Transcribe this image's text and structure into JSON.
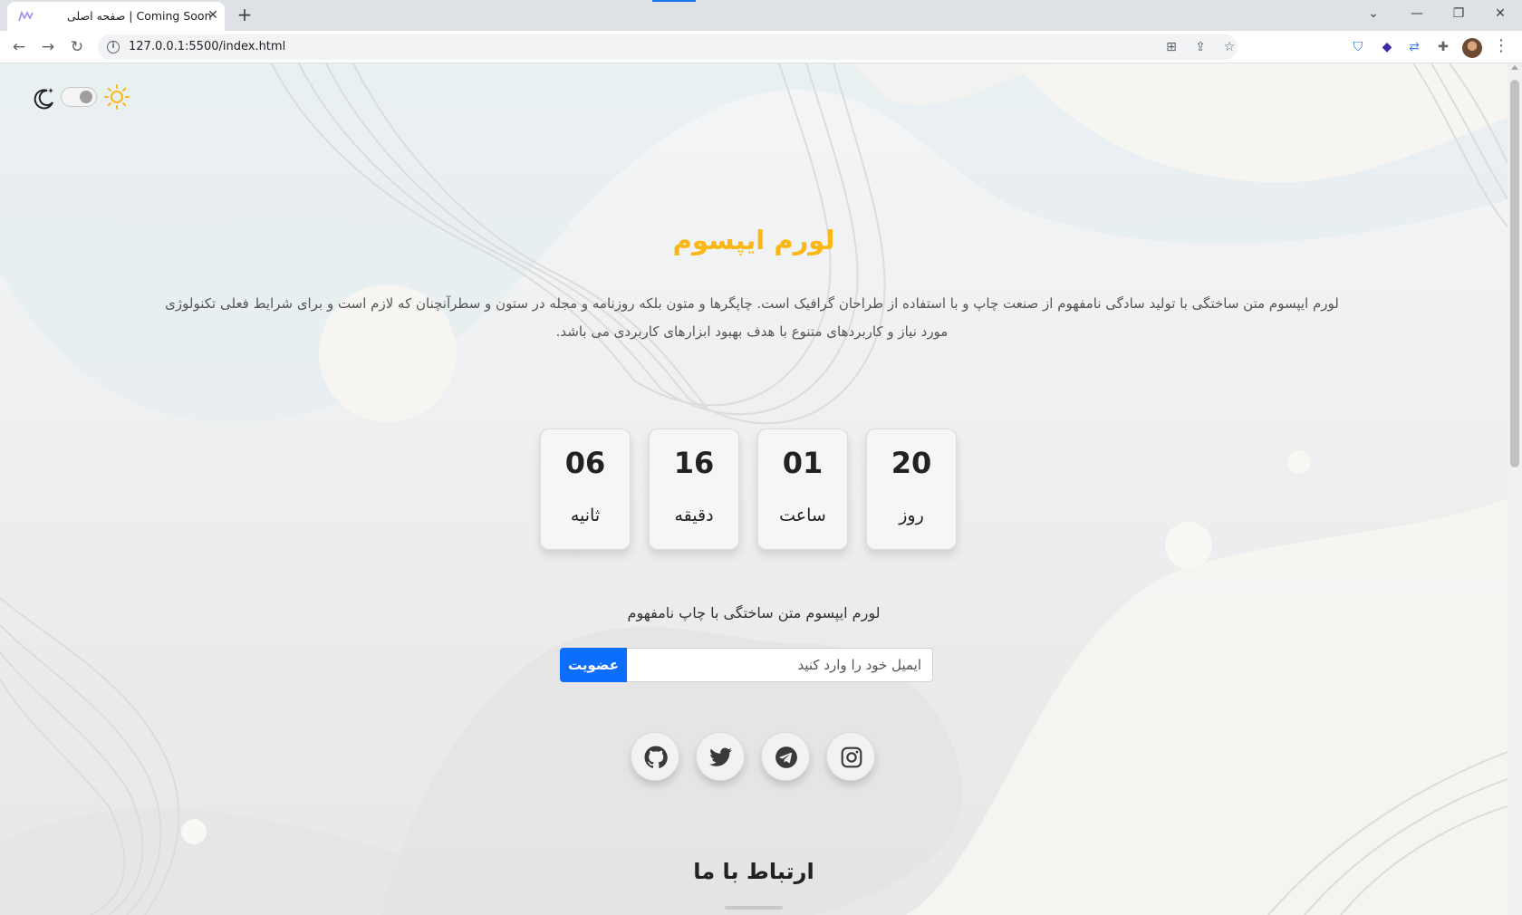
{
  "browser": {
    "tab_title": "صفحه اصلی | Coming Soon",
    "url": "127.0.0.1:5500/index.html"
  },
  "page": {
    "title": "لورم ایپسوم",
    "description": "لورم ایپسوم متن ساختگی با تولید سادگی نامفهوم از صنعت چاپ و با استفاده از طراحان گرافیک است. چاپگرها و متون بلکه روزنامه و مجله در ستون و سطرآنچنان که لازم است و برای شرایط فعلی تکنولوژی مورد نیاز و کاربردهای متنوع با هدف بهبود ابزارهای کاربردی می باشد.",
    "countdown": [
      {
        "value": "06",
        "label": "ثانیه"
      },
      {
        "value": "16",
        "label": "دقیقه"
      },
      {
        "value": "01",
        "label": "ساعت"
      },
      {
        "value": "20",
        "label": "روز"
      }
    ],
    "subscribe_text": "لورم ایپسوم متن ساختگی با چاپ نامفهوم",
    "subscribe_button": "عضویت",
    "email_placeholder": "ایمیل خود را وارد کنید",
    "contact_title": "ارتباط با ما"
  },
  "colors": {
    "title": "#fbb713",
    "button": "#0d6efd"
  },
  "icons": {
    "socials": [
      "github-icon",
      "twitter-icon",
      "telegram-icon",
      "instagram-icon"
    ]
  }
}
